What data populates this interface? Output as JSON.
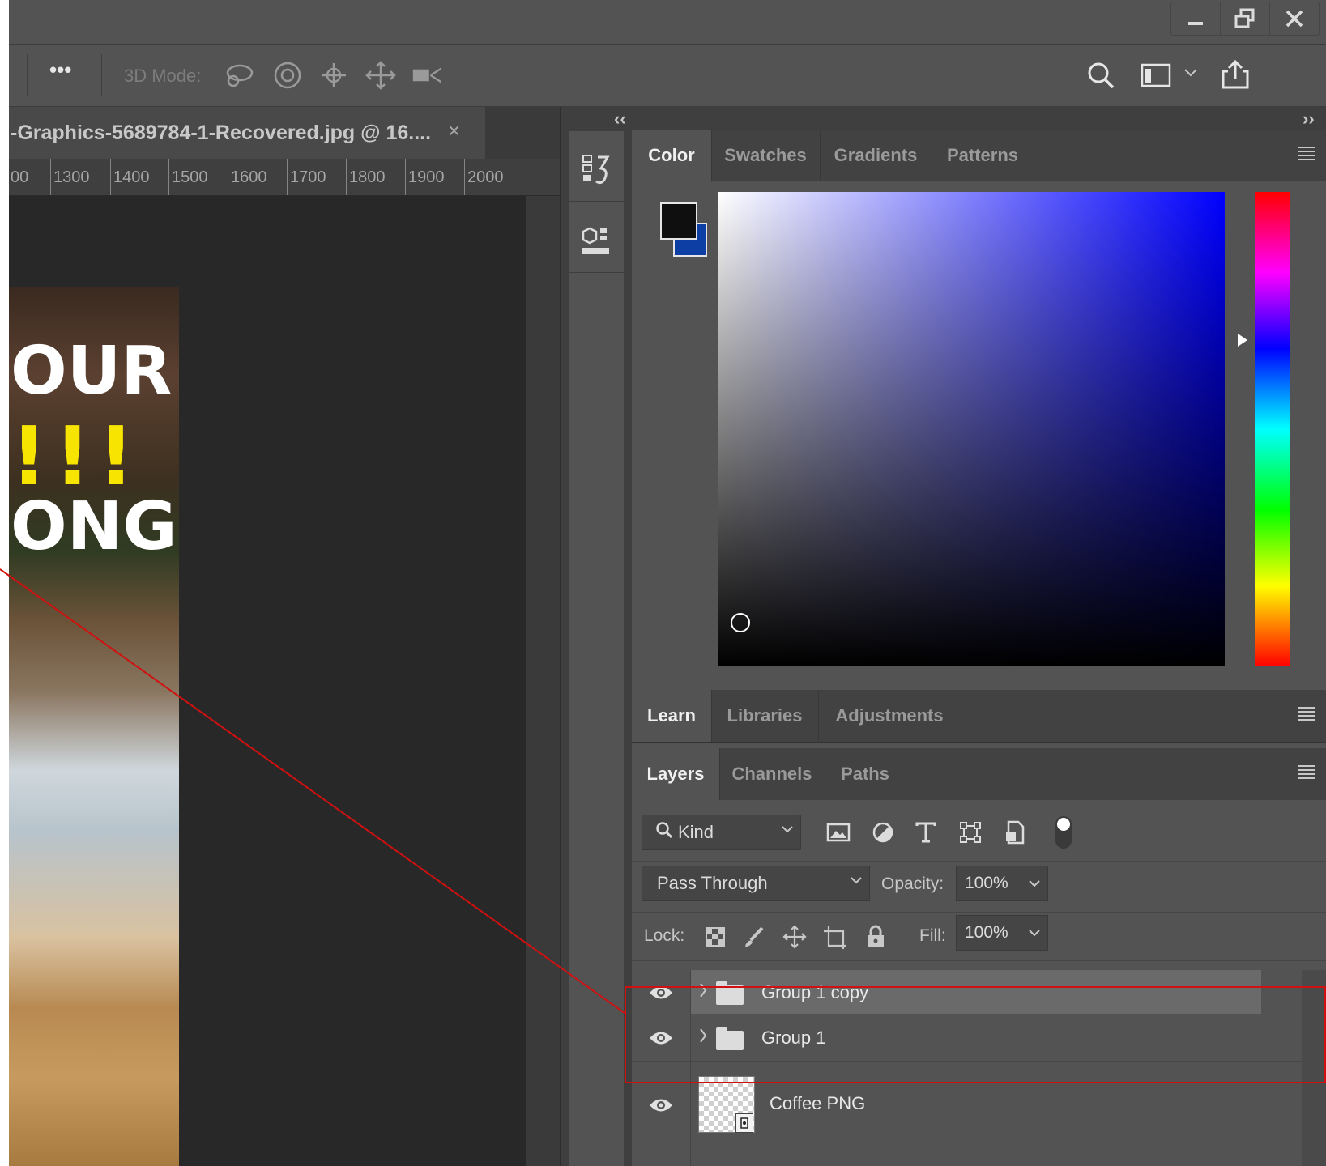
{
  "window": {
    "minimize_icon": "minimize-icon",
    "restore_icon": "restore-icon",
    "close_icon": "close-icon"
  },
  "options_bar": {
    "more_label": "•••",
    "mode_label": "3D Mode:",
    "tools": [
      "orbit-3d-icon",
      "roll-3d-icon",
      "pan-3d-icon",
      "slide-3d-icon",
      "camera-3d-icon"
    ],
    "search_icon": "search-icon",
    "workspace_icon": "workspace-icon",
    "share_icon": "share-icon"
  },
  "document": {
    "tab_title": "-Graphics-5689784-1-Recovered.jpg @ 16....",
    "close_label": "×",
    "ruler_labels": [
      "00",
      "1300",
      "1400",
      "1500",
      "1600",
      "1700",
      "1800",
      "1900",
      "2000"
    ],
    "canvas_text": {
      "line1": "OUR",
      "line2": "!!!",
      "line3": "ONG"
    }
  },
  "dock": {
    "collapse_left": "‹‹",
    "collapse_right": "››",
    "buttons": [
      "history-panel-icon",
      "3d-panel-icon"
    ]
  },
  "color_panel": {
    "tabs": [
      "Color",
      "Swatches",
      "Gradients",
      "Patterns"
    ],
    "active_tab": "Color",
    "foreground_color": "#0f0f0f",
    "background_color": "#0d3ea3",
    "hue_color": "#0000ff"
  },
  "learn_panel": {
    "tabs": [
      "Learn",
      "Libraries",
      "Adjustments"
    ],
    "active_tab": "Learn"
  },
  "layers_panel": {
    "tabs": [
      "Layers",
      "Channels",
      "Paths"
    ],
    "active_tab": "Layers",
    "filter_label": "Kind",
    "blend_mode": "Pass Through",
    "opacity_label": "Opacity:",
    "opacity_value": "100%",
    "lock_label": "Lock:",
    "fill_label": "Fill:",
    "fill_value": "100%",
    "layers": [
      {
        "name": "Group 1 copy",
        "type": "group",
        "selected": true
      },
      {
        "name": "Group 1",
        "type": "group",
        "selected": false
      },
      {
        "name": "Coffee PNG",
        "type": "smart-object",
        "selected": false
      }
    ]
  },
  "annotation": {
    "color": "#d11010"
  }
}
